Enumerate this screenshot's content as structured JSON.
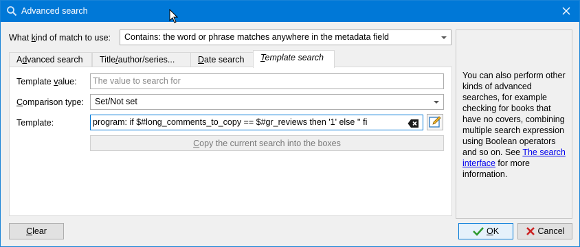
{
  "window": {
    "title": "Advanced search"
  },
  "match": {
    "label_prefix": "What ",
    "label_accel": "k",
    "label_suffix": "ind of match to use:",
    "selected": "Contains: the word or phrase matches anywhere in the metadata field"
  },
  "tabs": [
    {
      "pre": "A",
      "accel": "d",
      "post": "vanced search"
    },
    {
      "pre": "Title",
      "accel": "/",
      "post": "author/series..."
    },
    {
      "pre": "",
      "accel": "D",
      "post": "ate search"
    },
    {
      "pre": "",
      "accel": "T",
      "post": "emplate search"
    }
  ],
  "form": {
    "template_value": {
      "label_pre": "Template ",
      "label_accel": "v",
      "label_post": "alue:",
      "placeholder": "The value to search for"
    },
    "comparison_type": {
      "label_pre": "",
      "label_accel": "C",
      "label_post": "omparison type:",
      "selected": "Set/Not set"
    },
    "template": {
      "label_pre": "Template:",
      "value": "program: if $#long_comments_to_copy == $#gr_reviews then '1' else '' fi"
    },
    "copy_button": {
      "accel": "C",
      "rest": "opy the current search into the boxes"
    }
  },
  "help": {
    "text_before": "You can also perform other kinds of advanced searches, for example checking for books that have no covers, combining multiple search expression using Boolean operators and so on. See ",
    "link": "The search interface",
    "text_after": " for more information."
  },
  "footer": {
    "clear": {
      "accel": "C",
      "rest": "lear"
    },
    "ok": {
      "accel": "O",
      "rest": "K"
    },
    "cancel": {
      "label": "Cancel"
    }
  },
  "colors": {
    "titlebar": "#0078d7",
    "link": "#0000ee",
    "ok_check": "#2e9a2e",
    "cancel_x": "#cc2222"
  }
}
